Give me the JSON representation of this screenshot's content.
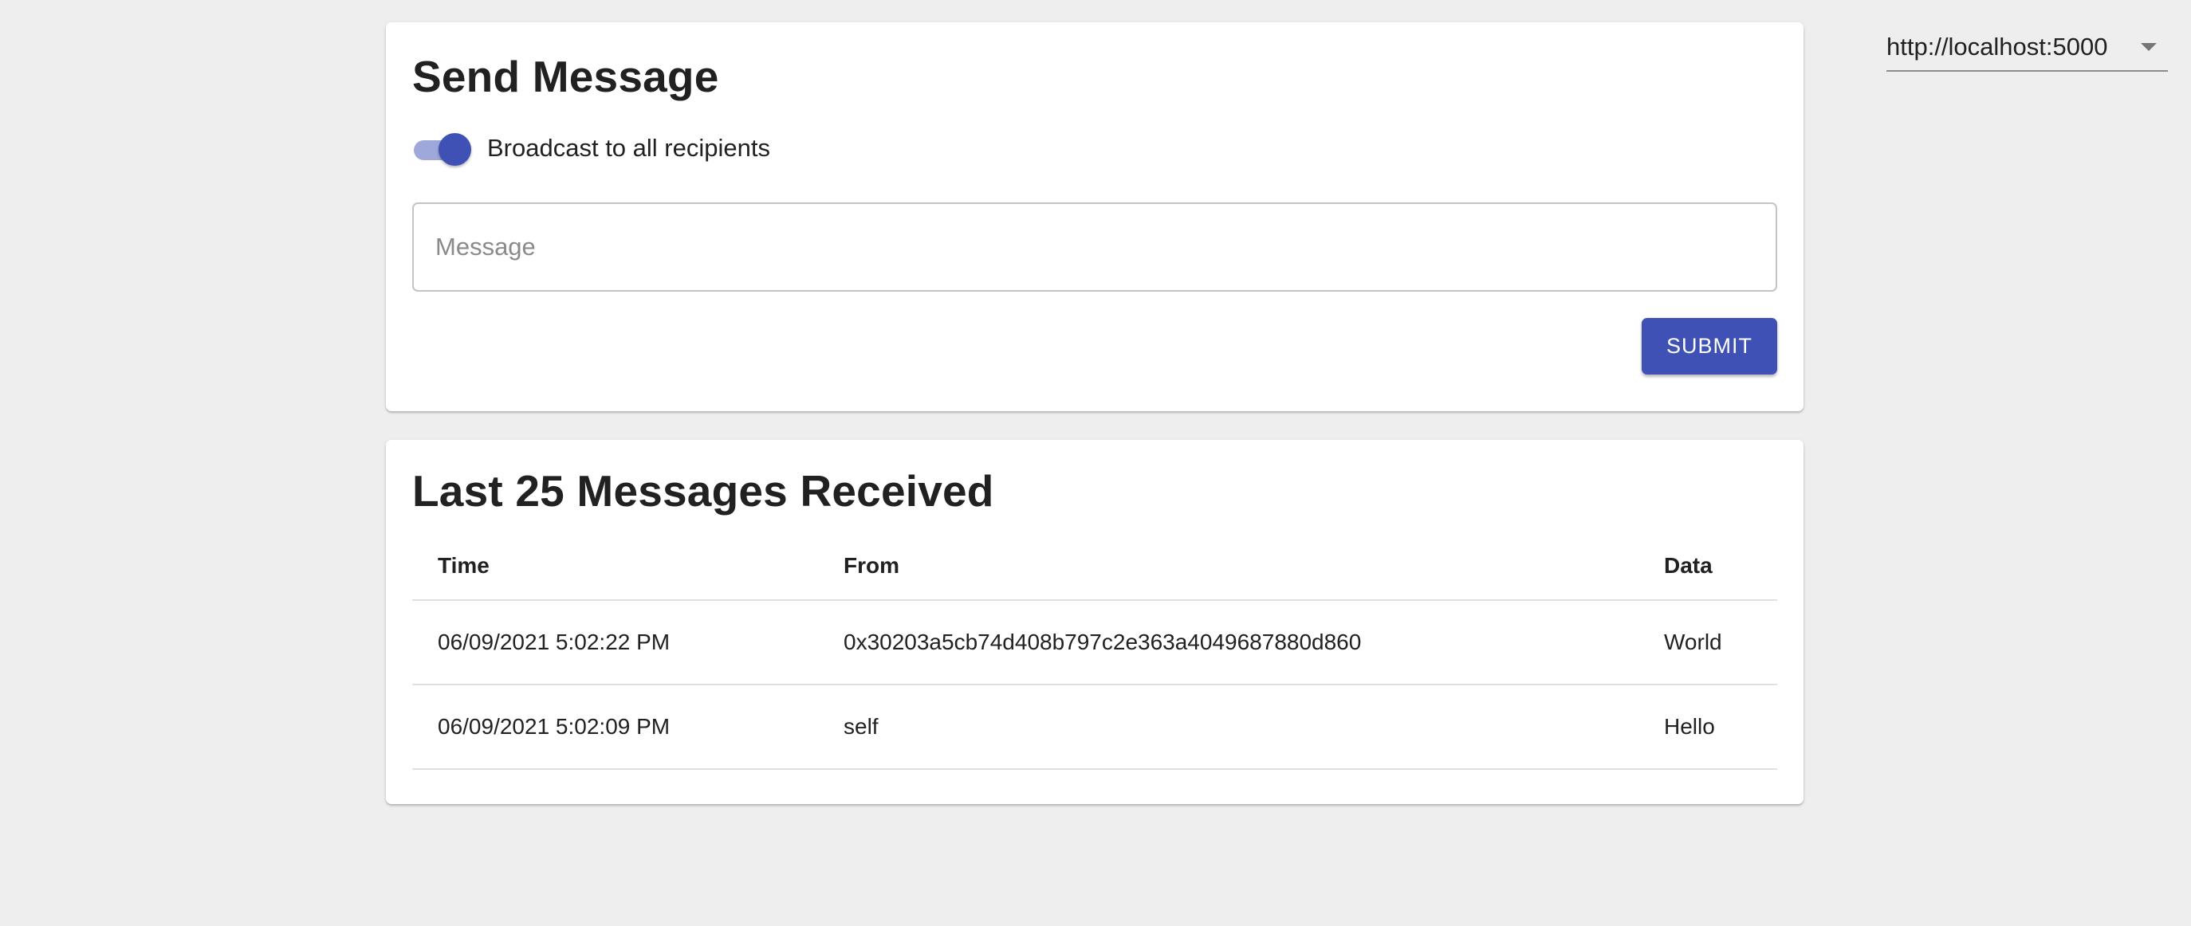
{
  "server": {
    "selected": "http://localhost:5000"
  },
  "send": {
    "title": "Send Message",
    "broadcast_label": "Broadcast to all recipients",
    "broadcast_on": true,
    "message_placeholder": "Message",
    "message_value": "",
    "submit_label": "SUBMIT"
  },
  "received": {
    "title": "Last 25 Messages Received",
    "columns": {
      "time": "Time",
      "from": "From",
      "data": "Data"
    },
    "rows": [
      {
        "time": "06/09/2021 5:02:22 PM",
        "from": "0x30203a5cb74d408b797c2e363a4049687880d860",
        "data": "World"
      },
      {
        "time": "06/09/2021 5:02:09 PM",
        "from": "self",
        "data": "Hello"
      }
    ]
  },
  "colors": {
    "accent": "#3f51b5",
    "accent_light": "#9fa8da",
    "background": "#eeeeee"
  }
}
